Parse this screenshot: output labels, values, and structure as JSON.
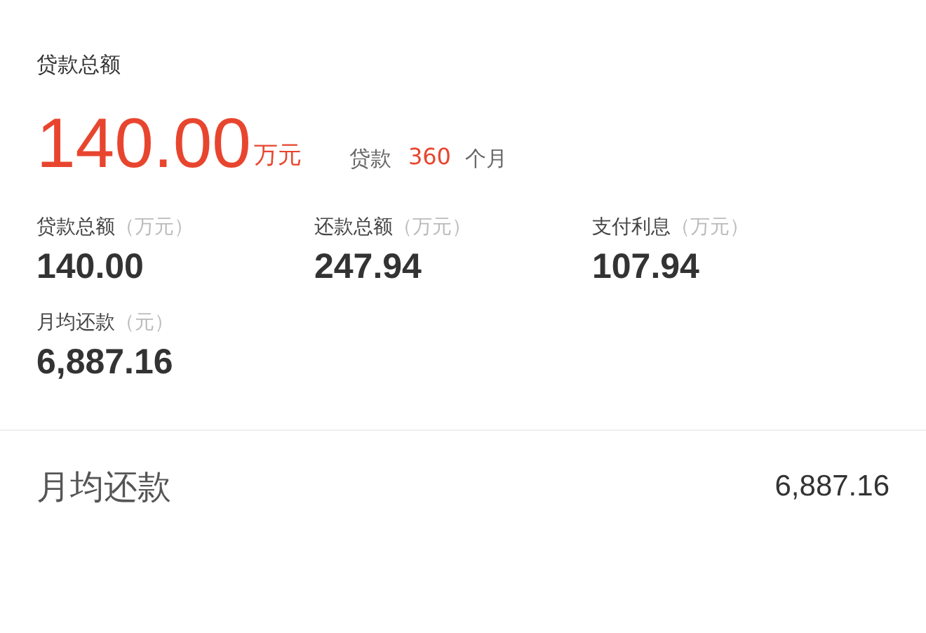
{
  "summary": {
    "label": "贷款总额",
    "amount": "140.00",
    "unit": "万元",
    "term_label": "贷款",
    "term_value": "360",
    "term_unit": "个月"
  },
  "stats": [
    {
      "label": "贷款总额",
      "unit": "（万元）",
      "value": "140.00"
    },
    {
      "label": "还款总额",
      "unit": "（万元）",
      "value": "247.94"
    },
    {
      "label": "支付利息",
      "unit": "（万元）",
      "value": "107.94"
    },
    {
      "label": "月均还款",
      "unit": "（元）",
      "value": "6,887.16"
    }
  ],
  "monthly_row": {
    "label": "月均还款",
    "value": "6,887.16"
  }
}
